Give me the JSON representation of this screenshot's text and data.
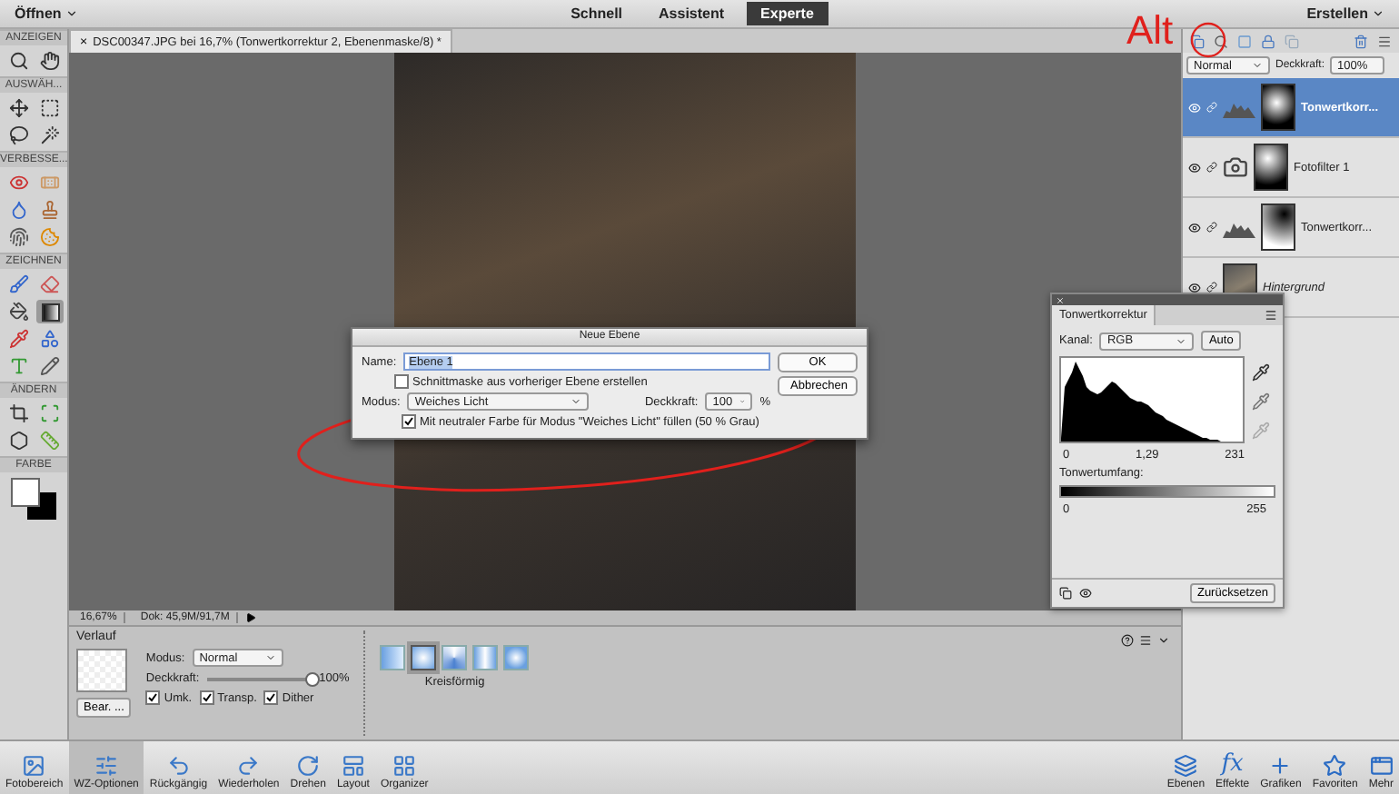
{
  "menu_bar": {
    "open_menu": "Öffnen",
    "modes": [
      {
        "label": "Schnell",
        "selected": false
      },
      {
        "label": "Assistent",
        "selected": false
      },
      {
        "label": "Experte",
        "selected": true
      }
    ],
    "create_menu": "Erstellen"
  },
  "toolbox": {
    "sections": [
      {
        "label": "ANZEIGEN",
        "tools": [
          {
            "selected": false
          },
          {
            "selected": false
          }
        ]
      },
      {
        "label": "AUSWÄH...",
        "tools": [
          {
            "selected": false
          },
          {
            "selected": false
          },
          {
            "selected": false
          },
          {
            "selected": false
          }
        ]
      },
      {
        "label": "VERBESSE...",
        "tools": [
          {
            "selected": false
          },
          {
            "selected": false
          },
          {
            "selected": false
          },
          {
            "selected": false
          },
          {
            "selected": false
          },
          {
            "selected": false
          }
        ]
      },
      {
        "label": "ZEICHNEN",
        "tools": [
          {
            "selected": false
          },
          {
            "selected": false
          },
          {
            "selected": false
          },
          {
            "selected": true
          },
          {
            "selected": false
          },
          {
            "selected": false
          },
          {
            "selected": false
          },
          {
            "selected": false
          }
        ]
      },
      {
        "label": "ÄNDERN",
        "tools": [
          {
            "selected": false
          },
          {
            "selected": false
          },
          {
            "selected": false
          },
          {
            "selected": false
          }
        ]
      }
    ],
    "color_label": "FARBE"
  },
  "document_tab": {
    "close": "×",
    "title": "DSC00347.JPG bei 16,7% (Tonwertkorrektur 2, Ebenenmaske/8) *"
  },
  "annotation": {
    "text": "Alt"
  },
  "layers_panel": {
    "blend_mode": "Normal",
    "opacity_label": "Deckkraft:",
    "opacity": "100%",
    "layers": [
      {
        "name": "Tonwertkorr...",
        "kind": "levels",
        "selected": true
      },
      {
        "name": "Fotofilter 1",
        "kind": "photo_filter",
        "selected": false
      },
      {
        "name": "Tonwertkorr...",
        "kind": "levels",
        "selected": false
      },
      {
        "name": "Hintergrund",
        "kind": "image",
        "selected": false
      }
    ]
  },
  "levels_panel": {
    "title": "Tonwertkorrektur",
    "channel_label": "Kanal:",
    "channel": "RGB",
    "auto": "Auto",
    "input_values": [
      "0",
      "1,29",
      "231"
    ],
    "output_label": "Tonwertumfang:",
    "output_values": [
      "0",
      "255"
    ],
    "reset": "Zurücksetzen"
  },
  "dialog": {
    "title": "Neue Ebene",
    "name_label": "Name:",
    "name": "Ebene 1",
    "clip_label": "Schnittmaske aus vorheriger Ebene erstellen",
    "clip_checked": false,
    "mode_label": "Modus:",
    "mode": "Weiches Licht",
    "opacity_label": "Deckkraft:",
    "opacity": "100",
    "percent": "%",
    "fill_label": "Mit neutraler Farbe für Modus \"Weiches Licht\" füllen (50 % Grau)",
    "fill_checked": true,
    "buttons": [
      "OK",
      "Abbrechen"
    ]
  },
  "status_bar": {
    "zoom": "16,67%",
    "doc": "Dok: 45,9M/91,7M"
  },
  "tool_options": {
    "title": "Verlauf",
    "edit_button": "Bear. ...",
    "mode_label": "Modus:",
    "mode": "Normal",
    "opacity_label": "Deckkraft:",
    "level": 1,
    "opacity": "100%",
    "options": [
      {
        "label": "Umk.",
        "checked": true
      },
      {
        "label": "Transp.",
        "checked": true
      },
      {
        "label": "Dither",
        "checked": true
      }
    ],
    "gradient_types": [
      {
        "selected": false
      },
      {
        "selected": true
      },
      {
        "selected": false
      },
      {
        "selected": false
      },
      {
        "selected": false
      }
    ],
    "gradient_type_label": "Kreisförmig"
  },
  "taskbar": {
    "left": [
      {
        "label": "Fotobereich",
        "selected": false
      },
      {
        "label": "WZ-Optionen",
        "selected": true
      },
      {
        "label": "Rückgängig",
        "selected": false
      },
      {
        "label": "Wiederholen",
        "selected": false
      },
      {
        "label": "Drehen",
        "selected": false
      },
      {
        "label": "Layout",
        "selected": false
      },
      {
        "label": "Organizer",
        "selected": false
      }
    ],
    "right": [
      {
        "label": "Ebenen"
      },
      {
        "glyph": "fx",
        "label": "Effekte"
      },
      {
        "label": "Grafiken"
      },
      {
        "label": "Favoriten"
      },
      {
        "label": "Mehr"
      }
    ]
  }
}
